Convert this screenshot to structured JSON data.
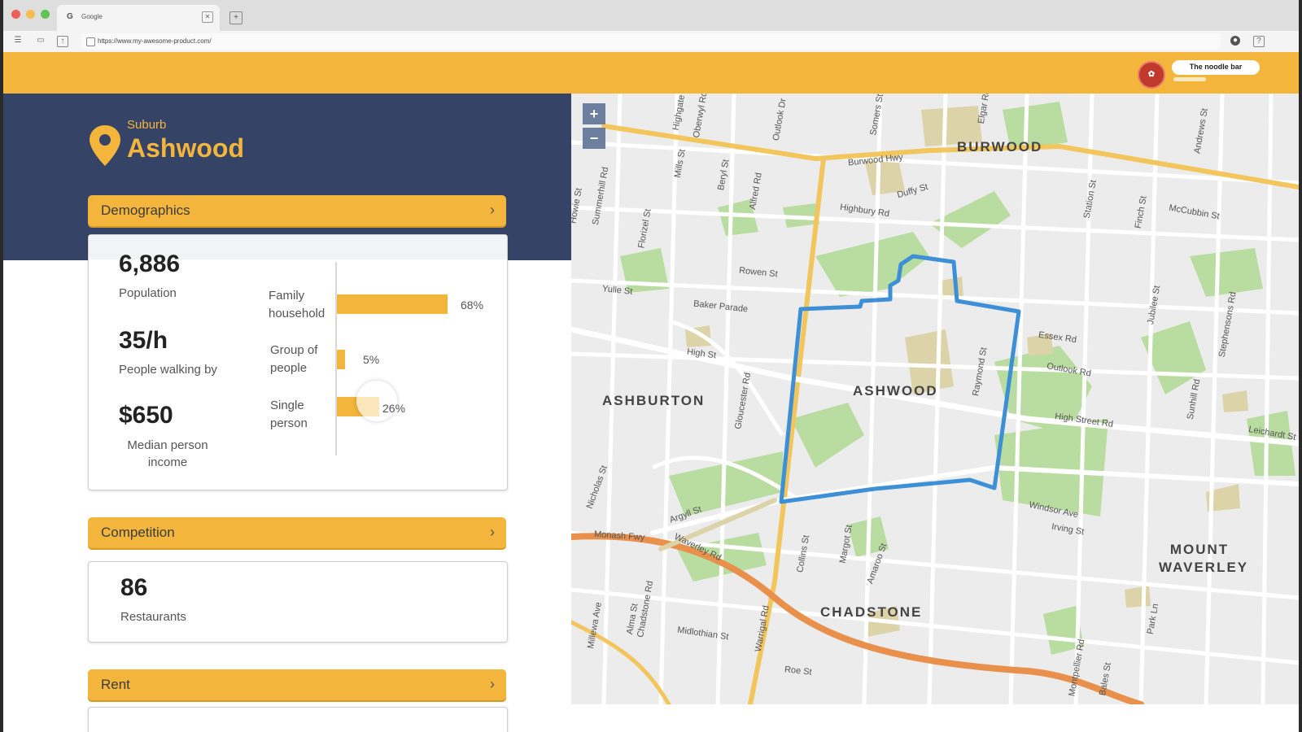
{
  "browser": {
    "tab_favicon": "G",
    "tab_title": "Google",
    "url": "https://www.my-awesome-product.com/",
    "close_glyph": "✕",
    "newtab_glyph": "+"
  },
  "header": {
    "avatar_glyph": "✿",
    "user_name": "The noodle bar",
    "brand_color": "#f3b53c",
    "navy_color": "#354466"
  },
  "suburb": {
    "label": "Suburb",
    "name": "Ashwood"
  },
  "demographics": {
    "title": "Demographics",
    "chevron": "›",
    "stats": [
      {
        "value": "6,886",
        "label": "Population"
      },
      {
        "value": "35/h",
        "label": "People walking by"
      },
      {
        "value": "$650",
        "label": "Median person income"
      }
    ],
    "household": [
      {
        "label": "Family household",
        "percent": "68%",
        "fraction": 0.68
      },
      {
        "label": "Group of people",
        "percent": "5%",
        "fraction": 0.05
      },
      {
        "label": "Single person",
        "percent": "26%",
        "fraction": 0.26
      }
    ]
  },
  "competition": {
    "title": "Competition",
    "chevron": "›",
    "value": "86",
    "label": "Restaurants"
  },
  "rent": {
    "title": "Rent",
    "chevron": "›"
  },
  "map": {
    "zoom_in": "+",
    "zoom_out": "−",
    "suburbs": [
      "BURWOOD",
      "ASHWOOD",
      "ASHBURTON",
      "CHADSTONE",
      "MOUNT WAVERLEY"
    ],
    "streets": [
      "Burwood Hwy",
      "Duffy St",
      "Highbury Rd",
      "Rowen St",
      "Yulle St",
      "Baker Parade",
      "High St",
      "Essex Rd",
      "Outlook Rd",
      "High Street Rd",
      "Argyll St",
      "Monash Fwy",
      "Waverley Rd",
      "Windsor Ave",
      "Irving St",
      "Midlothian St",
      "Warrigal Rd",
      "Chadstone Rd",
      "Collins St",
      "Margot St",
      "Station St",
      "Jubilee St",
      "Stephensons Rd",
      "McCubbin St",
      "Raymond St",
      "Summerhill Rd",
      "Gloucester Rd",
      "Roe St",
      "Andrews St",
      "Alfred Rd",
      "Beryl St",
      "Mills St",
      "Florizel St",
      "Finch St",
      "Sunhill Rd",
      "Bales St",
      "Park Ln",
      "Montpellier Rd",
      "Amaroo St",
      "Alma St",
      "Millewa Ave",
      "Nicholas St",
      "Elgar Rd",
      "Somers St",
      "Oberwyl Rd",
      "Outlook Dr",
      "Highgate Gr",
      "Howie St",
      "Leichardt St"
    ],
    "boundary_color": "#3d8fd6"
  }
}
